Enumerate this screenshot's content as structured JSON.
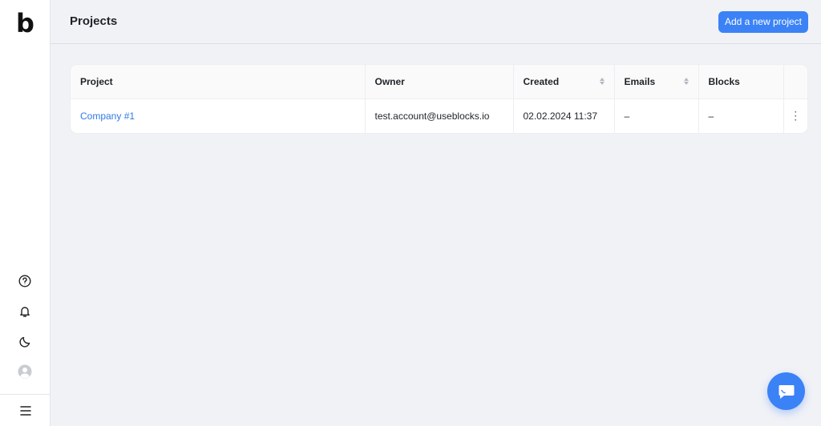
{
  "app": {
    "logo_text": "b"
  },
  "header": {
    "title": "Projects",
    "add_button_label": "Add a new project"
  },
  "sidebar": {
    "icons": [
      "help-icon",
      "bell-icon",
      "moon-icon",
      "avatar-icon"
    ],
    "menu_icon": "hamburger-menu-icon"
  },
  "table": {
    "columns": [
      {
        "label": "Project",
        "sortable": false
      },
      {
        "label": "Owner",
        "sortable": false
      },
      {
        "label": "Created",
        "sortable": true
      },
      {
        "label": "Emails",
        "sortable": true
      },
      {
        "label": "Blocks",
        "sortable": false
      }
    ],
    "rows": [
      {
        "project": "Company #1",
        "owner": "test.account@useblocks.io",
        "created": "02.02.2024 11:37",
        "emails": "–",
        "blocks": "–",
        "menu": "⋮"
      }
    ]
  },
  "colors": {
    "accent": "#3b82f6",
    "link": "#2f7ae5",
    "background": "#f1f2f6"
  }
}
